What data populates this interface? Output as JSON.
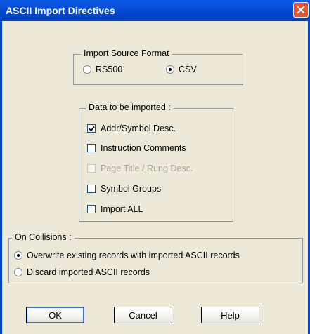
{
  "window": {
    "title": "ASCII Import Directives"
  },
  "source_format": {
    "label": "Import Source Format",
    "options": [
      {
        "label": "RS500",
        "selected": false
      },
      {
        "label": "CSV",
        "selected": true
      }
    ]
  },
  "data_imported": {
    "label": "Data to be imported  :",
    "items": [
      {
        "label": "Addr/Symbol Desc.",
        "checked": true,
        "enabled": true
      },
      {
        "label": "Instruction Comments",
        "checked": false,
        "enabled": true
      },
      {
        "label": "Page Title / Rung Desc.",
        "checked": false,
        "enabled": false
      },
      {
        "label": "Symbol Groups",
        "checked": false,
        "enabled": true
      },
      {
        "label": "Import ALL",
        "checked": false,
        "enabled": true
      }
    ]
  },
  "collisions": {
    "label": "On Collisions :",
    "options": [
      {
        "label": "Overwrite existing records with imported ASCII records",
        "selected": true
      },
      {
        "label": "Discard imported ASCII records",
        "selected": false
      }
    ]
  },
  "buttons": {
    "ok": "OK",
    "cancel": "Cancel",
    "help": "Help"
  }
}
